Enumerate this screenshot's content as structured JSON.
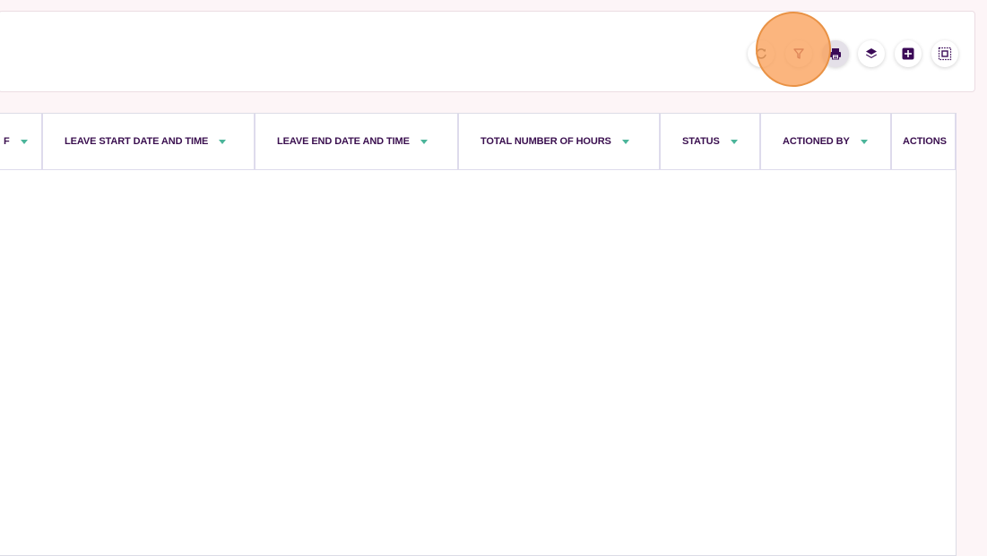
{
  "toolbar": {
    "buttons": [
      {
        "icon": "refresh-icon",
        "label": "Refresh"
      },
      {
        "icon": "filter-icon",
        "label": "Filter"
      },
      {
        "icon": "print-icon",
        "label": "Print"
      },
      {
        "icon": "layers-icon",
        "label": "Layers"
      },
      {
        "icon": "add-icon",
        "label": "Add"
      },
      {
        "icon": "select-all-icon",
        "label": "Select all"
      }
    ]
  },
  "table": {
    "columns": [
      {
        "label": "F"
      },
      {
        "label": "LEAVE START DATE AND TIME"
      },
      {
        "label": "LEAVE END DATE AND TIME"
      },
      {
        "label": "TOTAL NUMBER OF HOURS"
      },
      {
        "label": "STATUS"
      },
      {
        "label": "ACTIONED BY"
      },
      {
        "label": "ACTIONS"
      }
    ],
    "rows": []
  },
  "colors": {
    "background": "#fdf5f7",
    "header_text": "#3a0f4f",
    "sort_arrow": "#4bb59a",
    "icon_primary": "#3b0a57",
    "click_indicator": "#f7a35c"
  }
}
